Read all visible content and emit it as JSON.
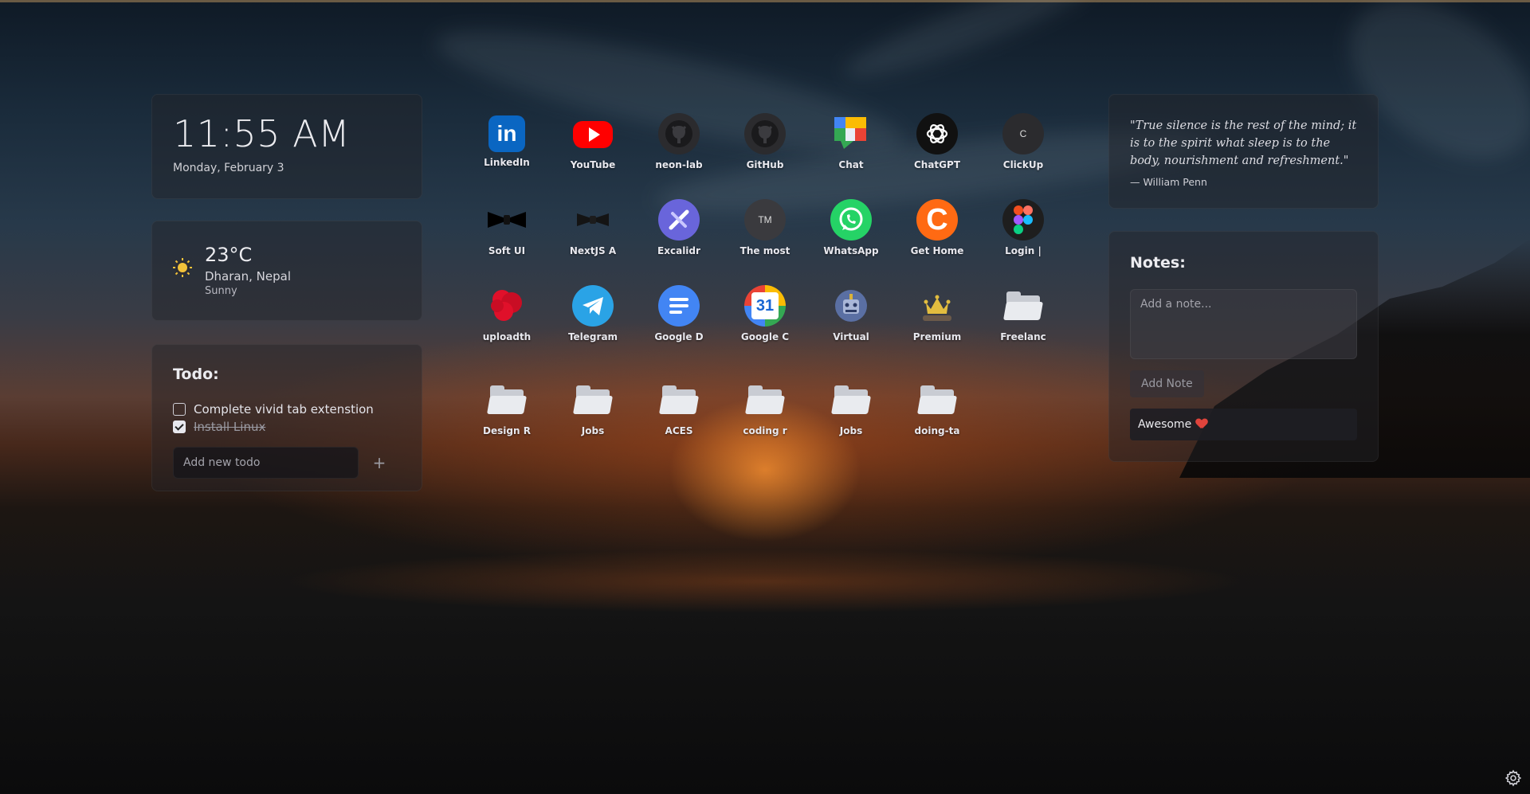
{
  "clock": {
    "time": "11:55 AM",
    "date": "Monday, February 3"
  },
  "weather": {
    "icon": "sun-icon",
    "temperature": "23°C",
    "location": "Dharan, Nepal",
    "condition": "Sunny"
  },
  "todo": {
    "title": "Todo:",
    "items": [
      {
        "text": "Complete vivid tab extenstion",
        "done": false
      },
      {
        "text": "Install Linux",
        "done": true
      }
    ],
    "input_placeholder": "Add new todo",
    "add_label": "+"
  },
  "shortcuts": [
    {
      "label": "LinkedIn",
      "icon": "linkedin-icon",
      "color": "#0a66c2"
    },
    {
      "label": "YouTube",
      "icon": "youtube-icon",
      "color": "#ff0000"
    },
    {
      "label": "neon-lab",
      "icon": "github-icon",
      "color": "#2b2b2e"
    },
    {
      "label": "GitHub",
      "icon": "github-icon",
      "color": "#2b2b2e"
    },
    {
      "label": "Chat",
      "icon": "google-chat-icon",
      "color": "#34a853"
    },
    {
      "label": "ChatGPT",
      "icon": "chatgpt-icon",
      "color": "#111111"
    },
    {
      "label": "ClickUp",
      "icon": "clickup-icon",
      "text": "C",
      "color": "#2b2b2e"
    },
    {
      "label": "Soft UI",
      "icon": "bowtie-icon",
      "color": "#000000"
    },
    {
      "label": "NextJS A",
      "icon": "bowtie-icon",
      "color": "#000000"
    },
    {
      "label": "Excalidr",
      "icon": "excalidraw-icon",
      "color": "#6965db"
    },
    {
      "label": "The most",
      "icon": "tm-icon",
      "text": "TM",
      "color": "#3a3a3e"
    },
    {
      "label": "WhatsApp",
      "icon": "whatsapp-icon",
      "color": "#25d366"
    },
    {
      "label": "Get Home",
      "icon": "get-home-icon",
      "text": "C",
      "color": "#ff6a13"
    },
    {
      "label": "Login |",
      "icon": "figma-icon",
      "color": "#1e1e1e"
    },
    {
      "label": "uploadth",
      "icon": "uploadthing-icon",
      "color": "#e0102a"
    },
    {
      "label": "Telegram",
      "icon": "telegram-icon",
      "color": "#2aa3e6"
    },
    {
      "label": "Google D",
      "icon": "google-docs-icon",
      "color": "#4285f4"
    },
    {
      "label": "Google C",
      "icon": "google-calendar-icon",
      "text": "31",
      "color": "#4285f4"
    },
    {
      "label": "Virtual",
      "icon": "virtual-icon",
      "color": "#6a7fb0"
    },
    {
      "label": "Premium",
      "icon": "crown-icon",
      "color": "#d9b23a"
    },
    {
      "label": "Freelanc",
      "icon": "folder-icon"
    },
    {
      "label": "Design R",
      "icon": "folder-icon"
    },
    {
      "label": "Jobs",
      "icon": "folder-icon"
    },
    {
      "label": "ACES",
      "icon": "folder-icon"
    },
    {
      "label": "coding r",
      "icon": "folder-icon"
    },
    {
      "label": "Jobs",
      "icon": "folder-icon"
    },
    {
      "label": "doing-ta",
      "icon": "folder-icon"
    }
  ],
  "quote": {
    "text": "\"True silence is the rest of the mind; it is to the spirit what sleep is to the body, nourishment and refreshment.\"",
    "author": "— William Penn"
  },
  "notes": {
    "title": "Notes:",
    "placeholder": "Add a note...",
    "add_label": "Add Note",
    "items": [
      {
        "text": "Awesome"
      }
    ]
  },
  "settings": {
    "icon": "gear-icon"
  }
}
